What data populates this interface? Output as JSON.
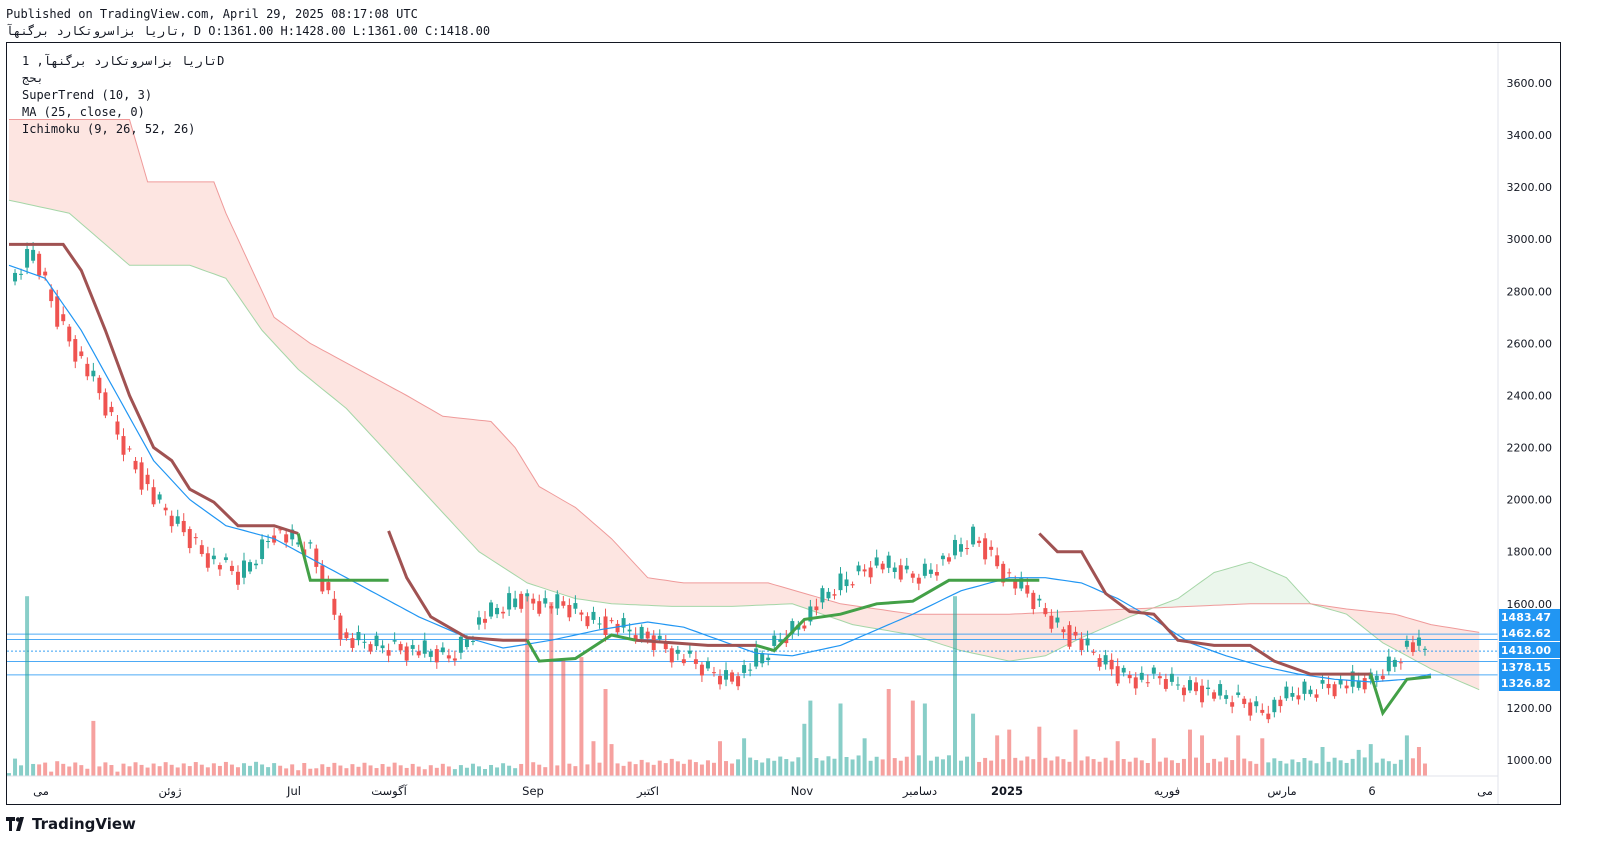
{
  "header": {
    "published": "Published on TradingView.com, April 29, 2025 08:17:08 UTC",
    "ohlc": "تاریا بزاسروتکارد برگنهآ, D O:1361.00 H:1428.00 L:1361.00 C:1418.00"
  },
  "legend": {
    "symbol_line": "تاریا بزاسروتکارد برگنهآ, 1D",
    "exchange": "بحج",
    "supertrend": "SuperTrend (10, 3)",
    "ma": "MA (25, close, 0)",
    "ichimoku": "Ichimoku (9, 26, 52, 26)"
  },
  "footer": {
    "brand": "TradingView"
  },
  "colors": {
    "up": "#26a69a",
    "down": "#ef5350",
    "supertrend_up": "#43a047",
    "supertrend_down": "#a05252",
    "ma": "#2196f3",
    "cloud_bear": "#fde0dc",
    "cloud_bull": "#e8f5e9",
    "badge": "#2196f3"
  },
  "chart_data": {
    "type": "candlestick",
    "title": "تاریا بزاسروتکارد برگنهآ, 1D",
    "ylim": [
      920,
      3760
    ],
    "y_ticks": [
      3600,
      3400,
      3200,
      3000,
      2800,
      2600,
      2400,
      2200,
      2000,
      1800,
      1600,
      1400,
      1200,
      1000
    ],
    "y_tick_labels": [
      "3600.00",
      "3400.00",
      "3200.00",
      "3000.00",
      "2800.00",
      "2600.00",
      "2400.00",
      "2200.00",
      "2000.00",
      "1800.00",
      "1600.00",
      "",
      "1200.00",
      "1000.00"
    ],
    "x_labels": [
      "می",
      "ژوئن",
      "Jul",
      "آگوست",
      "Sep",
      "اکتبر",
      "Nov",
      "دسامبر",
      "2025",
      "فوریه",
      "مارس",
      "6",
      "می"
    ],
    "x_label_positions": [
      0.034,
      0.163,
      0.287,
      0.382,
      0.526,
      0.641,
      0.795,
      0.913,
      1.0,
      1.16,
      1.275,
      1.365,
      1.478
    ],
    "price_levels": [
      {
        "label": "1483.47",
        "value": 1483.47
      },
      {
        "label": "1462.62",
        "value": 1462.62
      },
      {
        "label": "1418.00",
        "value": 1418.0
      },
      {
        "label": "1378.15",
        "value": 1378.15
      },
      {
        "label": "1326.82",
        "value": 1326.82
      }
    ],
    "close_anchors": [
      [
        0,
        2820
      ],
      [
        4,
        2950
      ],
      [
        8,
        2700
      ],
      [
        14,
        2450
      ],
      [
        18,
        2250
      ],
      [
        24,
        2000
      ],
      [
        32,
        1800
      ],
      [
        38,
        1700
      ],
      [
        44,
        1880
      ],
      [
        50,
        1800
      ],
      [
        56,
        1450
      ],
      [
        62,
        1440
      ],
      [
        68,
        1420
      ],
      [
        73,
        1390
      ],
      [
        78,
        1530
      ],
      [
        84,
        1620
      ],
      [
        90,
        1600
      ],
      [
        96,
        1550
      ],
      [
        102,
        1500
      ],
      [
        108,
        1450
      ],
      [
        114,
        1360
      ],
      [
        120,
        1310
      ],
      [
        126,
        1420
      ],
      [
        132,
        1550
      ],
      [
        138,
        1680
      ],
      [
        144,
        1760
      ],
      [
        150,
        1700
      ],
      [
        156,
        1780
      ],
      [
        160,
        1860
      ],
      [
        166,
        1700
      ],
      [
        172,
        1560
      ],
      [
        178,
        1440
      ],
      [
        184,
        1330
      ],
      [
        190,
        1310
      ],
      [
        196,
        1280
      ],
      [
        202,
        1240
      ],
      [
        208,
        1190
      ],
      [
        214,
        1260
      ],
      [
        220,
        1290
      ],
      [
        226,
        1300
      ],
      [
        232,
        1440
      ],
      [
        235,
        1418
      ]
    ],
    "supertrend": {
      "down_segments": [
        [
          [
            0,
            2980
          ],
          [
            9,
            2980
          ],
          [
            12,
            2880
          ],
          [
            16,
            2650
          ],
          [
            20,
            2400
          ],
          [
            24,
            2200
          ],
          [
            27,
            2150
          ],
          [
            30,
            2040
          ],
          [
            34,
            1990
          ],
          [
            38,
            1900
          ],
          [
            44,
            1900
          ],
          [
            48,
            1870
          ]
        ],
        [
          [
            63,
            1880
          ],
          [
            66,
            1700
          ],
          [
            70,
            1550
          ],
          [
            76,
            1470
          ],
          [
            82,
            1460
          ],
          [
            86,
            1460
          ]
        ],
        [
          [
            104,
            1460
          ],
          [
            110,
            1450
          ],
          [
            116,
            1440
          ],
          [
            120,
            1440
          ],
          [
            124,
            1440
          ]
        ],
        [
          [
            171,
            1870
          ],
          [
            174,
            1800
          ],
          [
            178,
            1800
          ],
          [
            182,
            1640
          ],
          [
            186,
            1570
          ],
          [
            190,
            1560
          ],
          [
            194,
            1460
          ],
          [
            200,
            1440
          ],
          [
            206,
            1440
          ],
          [
            210,
            1380
          ],
          [
            216,
            1330
          ],
          [
            222,
            1330
          ],
          [
            226,
            1330
          ]
        ]
      ],
      "up_segments": [
        [
          [
            48,
            1870
          ],
          [
            50,
            1690
          ],
          [
            58,
            1690
          ],
          [
            63,
            1690
          ]
        ],
        [
          [
            86,
            1460
          ],
          [
            88,
            1380
          ],
          [
            94,
            1390
          ],
          [
            100,
            1480
          ],
          [
            104,
            1460
          ]
        ],
        [
          [
            124,
            1440
          ],
          [
            127,
            1420
          ],
          [
            132,
            1540
          ],
          [
            138,
            1560
          ],
          [
            144,
            1600
          ],
          [
            150,
            1610
          ],
          [
            156,
            1690
          ],
          [
            164,
            1690
          ],
          [
            171,
            1690
          ]
        ],
        [
          [
            226,
            1330
          ],
          [
            228,
            1180
          ],
          [
            232,
            1310
          ],
          [
            236,
            1320
          ]
        ]
      ]
    },
    "ma": [
      [
        0,
        2900
      ],
      [
        6,
        2850
      ],
      [
        12,
        2650
      ],
      [
        18,
        2400
      ],
      [
        24,
        2150
      ],
      [
        30,
        2000
      ],
      [
        36,
        1900
      ],
      [
        44,
        1850
      ],
      [
        52,
        1750
      ],
      [
        60,
        1650
      ],
      [
        68,
        1550
      ],
      [
        76,
        1470
      ],
      [
        82,
        1430
      ],
      [
        90,
        1460
      ],
      [
        98,
        1500
      ],
      [
        106,
        1530
      ],
      [
        112,
        1510
      ],
      [
        118,
        1460
      ],
      [
        124,
        1410
      ],
      [
        130,
        1400
      ],
      [
        138,
        1440
      ],
      [
        144,
        1500
      ],
      [
        150,
        1560
      ],
      [
        158,
        1650
      ],
      [
        166,
        1700
      ],
      [
        172,
        1700
      ],
      [
        178,
        1680
      ],
      [
        184,
        1620
      ],
      [
        190,
        1540
      ],
      [
        196,
        1450
      ],
      [
        202,
        1400
      ],
      [
        208,
        1360
      ],
      [
        214,
        1330
      ],
      [
        220,
        1310
      ],
      [
        226,
        1300
      ],
      [
        232,
        1310
      ],
      [
        236,
        1330
      ]
    ],
    "cloud": {
      "span_a": [
        [
          0,
          3150
        ],
        [
          10,
          3100
        ],
        [
          20,
          2900
        ],
        [
          30,
          2900
        ],
        [
          36,
          2850
        ],
        [
          42,
          2650
        ],
        [
          48,
          2500
        ],
        [
          56,
          2350
        ],
        [
          64,
          2150
        ],
        [
          72,
          1950
        ],
        [
          78,
          1800
        ],
        [
          86,
          1680
        ],
        [
          94,
          1620
        ],
        [
          100,
          1600
        ],
        [
          110,
          1590
        ],
        [
          120,
          1590
        ],
        [
          130,
          1600
        ],
        [
          140,
          1520
        ],
        [
          150,
          1480
        ],
        [
          158,
          1420
        ],
        [
          166,
          1380
        ],
        [
          172,
          1400
        ],
        [
          178,
          1470
        ],
        [
          186,
          1550
        ],
        [
          194,
          1620
        ],
        [
          200,
          1720
        ],
        [
          206,
          1760
        ],
        [
          212,
          1700
        ],
        [
          216,
          1600
        ],
        [
          222,
          1560
        ],
        [
          228,
          1450
        ],
        [
          236,
          1350
        ],
        [
          244,
          1270
        ]
      ],
      "span_b": [
        [
          0,
          3460
        ],
        [
          20,
          3460
        ],
        [
          23,
          3220
        ],
        [
          34,
          3220
        ],
        [
          36,
          3100
        ],
        [
          44,
          2700
        ],
        [
          50,
          2600
        ],
        [
          58,
          2500
        ],
        [
          66,
          2400
        ],
        [
          72,
          2320
        ],
        [
          80,
          2300
        ],
        [
          84,
          2200
        ],
        [
          88,
          2050
        ],
        [
          94,
          1970
        ],
        [
          100,
          1850
        ],
        [
          106,
          1700
        ],
        [
          112,
          1680
        ],
        [
          118,
          1680
        ],
        [
          126,
          1680
        ],
        [
          138,
          1600
        ],
        [
          150,
          1560
        ],
        [
          166,
          1560
        ],
        [
          176,
          1570
        ],
        [
          186,
          1580
        ],
        [
          196,
          1590
        ],
        [
          206,
          1600
        ],
        [
          216,
          1600
        ],
        [
          222,
          1580
        ],
        [
          230,
          1560
        ],
        [
          236,
          1520
        ],
        [
          244,
          1490
        ]
      ]
    },
    "volume_peaks": [
      [
        0,
        10
      ],
      [
        1,
        60
      ],
      [
        3,
        620
      ],
      [
        5,
        40
      ],
      [
        7,
        15
      ],
      [
        13,
        25
      ],
      [
        14,
        190
      ],
      [
        18,
        15
      ],
      [
        48,
        20
      ],
      [
        50,
        25
      ],
      [
        86,
        620
      ],
      [
        90,
        600
      ],
      [
        92,
        400
      ],
      [
        95,
        410
      ],
      [
        97,
        120
      ],
      [
        99,
        300
      ],
      [
        100,
        110
      ],
      [
        118,
        120
      ],
      [
        122,
        130
      ],
      [
        132,
        180
      ],
      [
        133,
        260
      ],
      [
        138,
        250
      ],
      [
        142,
        130
      ],
      [
        146,
        300
      ],
      [
        150,
        260
      ],
      [
        152,
        250
      ],
      [
        157,
        620
      ],
      [
        160,
        215
      ],
      [
        164,
        140
      ],
      [
        166,
        160
      ],
      [
        171,
        170
      ],
      [
        177,
        160
      ],
      [
        184,
        120
      ],
      [
        190,
        130
      ],
      [
        196,
        160
      ],
      [
        198,
        140
      ],
      [
        204,
        140
      ],
      [
        208,
        130
      ],
      [
        218,
        100
      ],
      [
        224,
        90
      ],
      [
        226,
        110
      ],
      [
        232,
        140
      ],
      [
        234,
        100
      ],
      [
        236,
        30
      ]
    ],
    "series": [
      {
        "name": "SuperTrend (10, 3)"
      },
      {
        "name": "MA (25, close, 0)"
      },
      {
        "name": "Ichimoku (9, 26, 52, 26)"
      }
    ]
  }
}
